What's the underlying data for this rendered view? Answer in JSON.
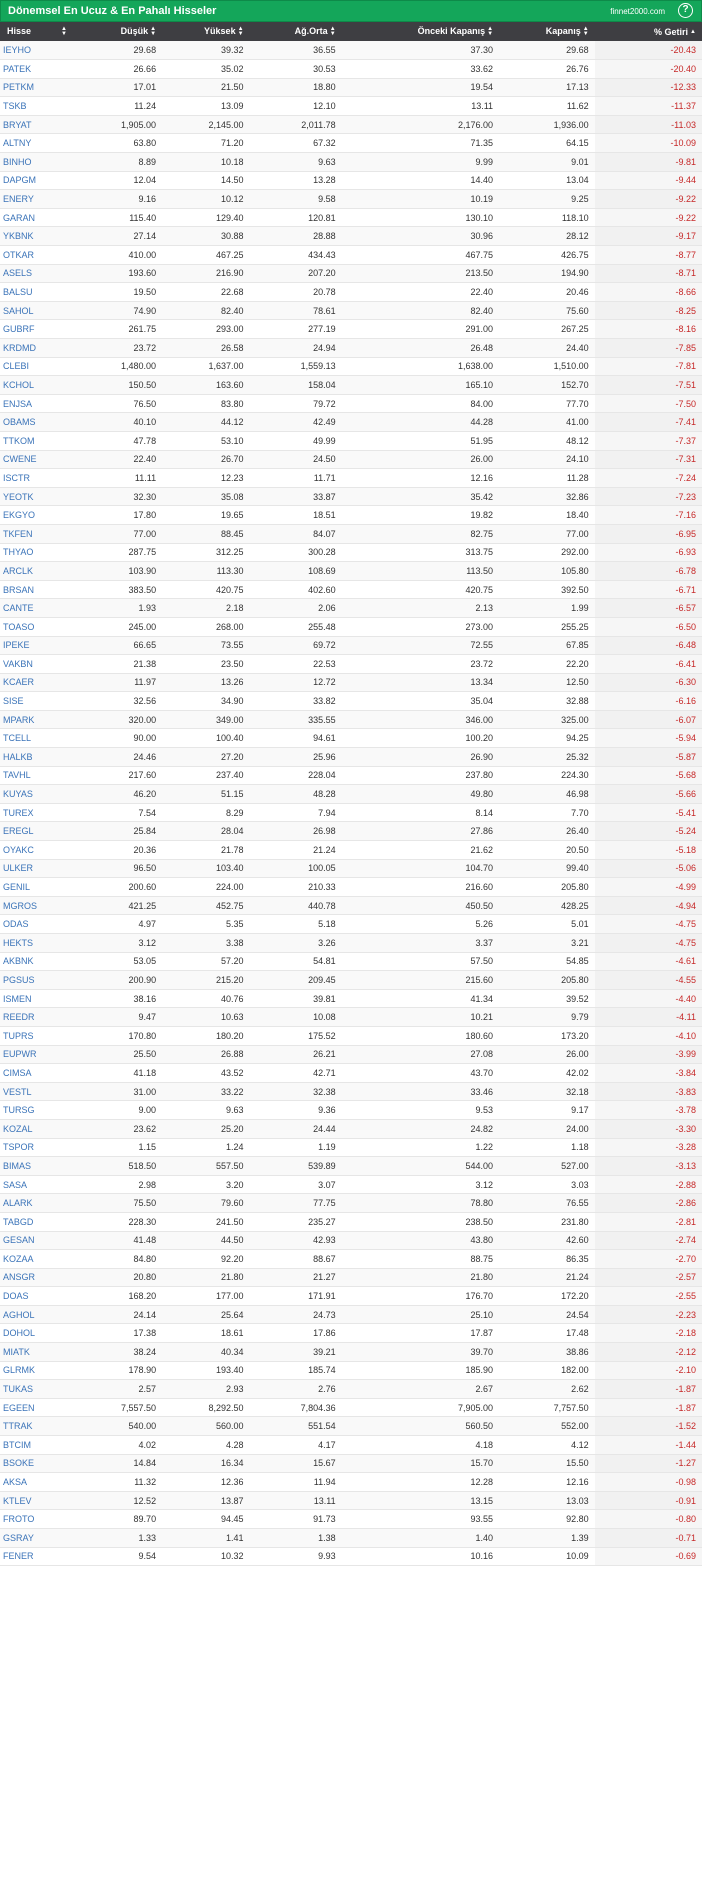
{
  "header": {
    "title": "Dönemsel En Ucuz & En Pahalı Hisseler",
    "brand": "finnet2000.com",
    "help": "?"
  },
  "columns": [
    "Hisse",
    "Düşük",
    "Yüksek",
    "Ağ.Orta",
    "Önceki Kapanış",
    "Kapanış",
    "% Getiri"
  ],
  "colors": {
    "header_bg": "#14a65a",
    "table_head_bg": "#3e3e42",
    "link": "#3a73b8",
    "negative": "#c62828"
  },
  "rows": [
    [
      "IEYHO",
      "29.68",
      "39.32",
      "36.55",
      "37.30",
      "29.68",
      "-20.43"
    ],
    [
      "PATEK",
      "26.66",
      "35.02",
      "30.53",
      "33.62",
      "26.76",
      "-20.40"
    ],
    [
      "PETKM",
      "17.01",
      "21.50",
      "18.80",
      "19.54",
      "17.13",
      "-12.33"
    ],
    [
      "TSKB",
      "11.24",
      "13.09",
      "12.10",
      "13.11",
      "11.62",
      "-11.37"
    ],
    [
      "BRYAT",
      "1,905.00",
      "2,145.00",
      "2,011.78",
      "2,176.00",
      "1,936.00",
      "-11.03"
    ],
    [
      "ALTNY",
      "63.80",
      "71.20",
      "67.32",
      "71.35",
      "64.15",
      "-10.09"
    ],
    [
      "BINHO",
      "8.89",
      "10.18",
      "9.63",
      "9.99",
      "9.01",
      "-9.81"
    ],
    [
      "DAPGM",
      "12.04",
      "14.50",
      "13.28",
      "14.40",
      "13.04",
      "-9.44"
    ],
    [
      "ENERY",
      "9.16",
      "10.12",
      "9.58",
      "10.19",
      "9.25",
      "-9.22"
    ],
    [
      "GARAN",
      "115.40",
      "129.40",
      "120.81",
      "130.10",
      "118.10",
      "-9.22"
    ],
    [
      "YKBNK",
      "27.14",
      "30.88",
      "28.88",
      "30.96",
      "28.12",
      "-9.17"
    ],
    [
      "OTKAR",
      "410.00",
      "467.25",
      "434.43",
      "467.75",
      "426.75",
      "-8.77"
    ],
    [
      "ASELS",
      "193.60",
      "216.90",
      "207.20",
      "213.50",
      "194.90",
      "-8.71"
    ],
    [
      "BALSU",
      "19.50",
      "22.68",
      "20.78",
      "22.40",
      "20.46",
      "-8.66"
    ],
    [
      "SAHOL",
      "74.90",
      "82.40",
      "78.61",
      "82.40",
      "75.60",
      "-8.25"
    ],
    [
      "GUBRF",
      "261.75",
      "293.00",
      "277.19",
      "291.00",
      "267.25",
      "-8.16"
    ],
    [
      "KRDMD",
      "23.72",
      "26.58",
      "24.94",
      "26.48",
      "24.40",
      "-7.85"
    ],
    [
      "CLEBI",
      "1,480.00",
      "1,637.00",
      "1,559.13",
      "1,638.00",
      "1,510.00",
      "-7.81"
    ],
    [
      "KCHOL",
      "150.50",
      "163.60",
      "158.04",
      "165.10",
      "152.70",
      "-7.51"
    ],
    [
      "ENJSA",
      "76.50",
      "83.80",
      "79.72",
      "84.00",
      "77.70",
      "-7.50"
    ],
    [
      "OBAMS",
      "40.10",
      "44.12",
      "42.49",
      "44.28",
      "41.00",
      "-7.41"
    ],
    [
      "TTKOM",
      "47.78",
      "53.10",
      "49.99",
      "51.95",
      "48.12",
      "-7.37"
    ],
    [
      "CWENE",
      "22.40",
      "26.70",
      "24.50",
      "26.00",
      "24.10",
      "-7.31"
    ],
    [
      "ISCTR",
      "11.11",
      "12.23",
      "11.71",
      "12.16",
      "11.28",
      "-7.24"
    ],
    [
      "YEOTK",
      "32.30",
      "35.08",
      "33.87",
      "35.42",
      "32.86",
      "-7.23"
    ],
    [
      "EKGYO",
      "17.80",
      "19.65",
      "18.51",
      "19.82",
      "18.40",
      "-7.16"
    ],
    [
      "TKFEN",
      "77.00",
      "88.45",
      "84.07",
      "82.75",
      "77.00",
      "-6.95"
    ],
    [
      "THYAO",
      "287.75",
      "312.25",
      "300.28",
      "313.75",
      "292.00",
      "-6.93"
    ],
    [
      "ARCLK",
      "103.90",
      "113.30",
      "108.69",
      "113.50",
      "105.80",
      "-6.78"
    ],
    [
      "BRSAN",
      "383.50",
      "420.75",
      "402.60",
      "420.75",
      "392.50",
      "-6.71"
    ],
    [
      "CANTE",
      "1.93",
      "2.18",
      "2.06",
      "2.13",
      "1.99",
      "-6.57"
    ],
    [
      "TOASO",
      "245.00",
      "268.00",
      "255.48",
      "273.00",
      "255.25",
      "-6.50"
    ],
    [
      "IPEKE",
      "66.65",
      "73.55",
      "69.72",
      "72.55",
      "67.85",
      "-6.48"
    ],
    [
      "VAKBN",
      "21.38",
      "23.50",
      "22.53",
      "23.72",
      "22.20",
      "-6.41"
    ],
    [
      "KCAER",
      "11.97",
      "13.26",
      "12.72",
      "13.34",
      "12.50",
      "-6.30"
    ],
    [
      "SISE",
      "32.56",
      "34.90",
      "33.82",
      "35.04",
      "32.88",
      "-6.16"
    ],
    [
      "MPARK",
      "320.00",
      "349.00",
      "335.55",
      "346.00",
      "325.00",
      "-6.07"
    ],
    [
      "TCELL",
      "90.00",
      "100.40",
      "94.61",
      "100.20",
      "94.25",
      "-5.94"
    ],
    [
      "HALKB",
      "24.46",
      "27.20",
      "25.96",
      "26.90",
      "25.32",
      "-5.87"
    ],
    [
      "TAVHL",
      "217.60",
      "237.40",
      "228.04",
      "237.80",
      "224.30",
      "-5.68"
    ],
    [
      "KUYAS",
      "46.20",
      "51.15",
      "48.28",
      "49.80",
      "46.98",
      "-5.66"
    ],
    [
      "TUREX",
      "7.54",
      "8.29",
      "7.94",
      "8.14",
      "7.70",
      "-5.41"
    ],
    [
      "EREGL",
      "25.84",
      "28.04",
      "26.98",
      "27.86",
      "26.40",
      "-5.24"
    ],
    [
      "OYAKC",
      "20.36",
      "21.78",
      "21.24",
      "21.62",
      "20.50",
      "-5.18"
    ],
    [
      "ULKER",
      "96.50",
      "103.40",
      "100.05",
      "104.70",
      "99.40",
      "-5.06"
    ],
    [
      "GENIL",
      "200.60",
      "224.00",
      "210.33",
      "216.60",
      "205.80",
      "-4.99"
    ],
    [
      "MGROS",
      "421.25",
      "452.75",
      "440.78",
      "450.50",
      "428.25",
      "-4.94"
    ],
    [
      "ODAS",
      "4.97",
      "5.35",
      "5.18",
      "5.26",
      "5.01",
      "-4.75"
    ],
    [
      "HEKTS",
      "3.12",
      "3.38",
      "3.26",
      "3.37",
      "3.21",
      "-4.75"
    ],
    [
      "AKBNK",
      "53.05",
      "57.20",
      "54.81",
      "57.50",
      "54.85",
      "-4.61"
    ],
    [
      "PGSUS",
      "200.90",
      "215.20",
      "209.45",
      "215.60",
      "205.80",
      "-4.55"
    ],
    [
      "ISMEN",
      "38.16",
      "40.76",
      "39.81",
      "41.34",
      "39.52",
      "-4.40"
    ],
    [
      "REEDR",
      "9.47",
      "10.63",
      "10.08",
      "10.21",
      "9.79",
      "-4.11"
    ],
    [
      "TUPRS",
      "170.80",
      "180.20",
      "175.52",
      "180.60",
      "173.20",
      "-4.10"
    ],
    [
      "EUPWR",
      "25.50",
      "26.88",
      "26.21",
      "27.08",
      "26.00",
      "-3.99"
    ],
    [
      "CIMSA",
      "41.18",
      "43.52",
      "42.71",
      "43.70",
      "42.02",
      "-3.84"
    ],
    [
      "VESTL",
      "31.00",
      "33.22",
      "32.38",
      "33.46",
      "32.18",
      "-3.83"
    ],
    [
      "TURSG",
      "9.00",
      "9.63",
      "9.36",
      "9.53",
      "9.17",
      "-3.78"
    ],
    [
      "KOZAL",
      "23.62",
      "25.20",
      "24.44",
      "24.82",
      "24.00",
      "-3.30"
    ],
    [
      "TSPOR",
      "1.15",
      "1.24",
      "1.19",
      "1.22",
      "1.18",
      "-3.28"
    ],
    [
      "BIMAS",
      "518.50",
      "557.50",
      "539.89",
      "544.00",
      "527.00",
      "-3.13"
    ],
    [
      "SASA",
      "2.98",
      "3.20",
      "3.07",
      "3.12",
      "3.03",
      "-2.88"
    ],
    [
      "ALARK",
      "75.50",
      "79.60",
      "77.75",
      "78.80",
      "76.55",
      "-2.86"
    ],
    [
      "TABGD",
      "228.30",
      "241.50",
      "235.27",
      "238.50",
      "231.80",
      "-2.81"
    ],
    [
      "GESAN",
      "41.48",
      "44.50",
      "42.93",
      "43.80",
      "42.60",
      "-2.74"
    ],
    [
      "KOZAA",
      "84.80",
      "92.20",
      "88.67",
      "88.75",
      "86.35",
      "-2.70"
    ],
    [
      "ANSGR",
      "20.80",
      "21.80",
      "21.27",
      "21.80",
      "21.24",
      "-2.57"
    ],
    [
      "DOAS",
      "168.20",
      "177.00",
      "171.91",
      "176.70",
      "172.20",
      "-2.55"
    ],
    [
      "AGHOL",
      "24.14",
      "25.64",
      "24.73",
      "25.10",
      "24.54",
      "-2.23"
    ],
    [
      "DOHOL",
      "17.38",
      "18.61",
      "17.86",
      "17.87",
      "17.48",
      "-2.18"
    ],
    [
      "MIATK",
      "38.24",
      "40.34",
      "39.21",
      "39.70",
      "38.86",
      "-2.12"
    ],
    [
      "GLRMK",
      "178.90",
      "193.40",
      "185.74",
      "185.90",
      "182.00",
      "-2.10"
    ],
    [
      "TUKAS",
      "2.57",
      "2.93",
      "2.76",
      "2.67",
      "2.62",
      "-1.87"
    ],
    [
      "EGEEN",
      "7,557.50",
      "8,292.50",
      "7,804.36",
      "7,905.00",
      "7,757.50",
      "-1.87"
    ],
    [
      "TTRAK",
      "540.00",
      "560.00",
      "551.54",
      "560.50",
      "552.00",
      "-1.52"
    ],
    [
      "BTCIM",
      "4.02",
      "4.28",
      "4.17",
      "4.18",
      "4.12",
      "-1.44"
    ],
    [
      "BSOKE",
      "14.84",
      "16.34",
      "15.67",
      "15.70",
      "15.50",
      "-1.27"
    ],
    [
      "AKSA",
      "11.32",
      "12.36",
      "11.94",
      "12.28",
      "12.16",
      "-0.98"
    ],
    [
      "KTLEV",
      "12.52",
      "13.87",
      "13.11",
      "13.15",
      "13.03",
      "-0.91"
    ],
    [
      "FROTO",
      "89.70",
      "94.45",
      "91.73",
      "93.55",
      "92.80",
      "-0.80"
    ],
    [
      "GSRAY",
      "1.33",
      "1.41",
      "1.38",
      "1.40",
      "1.39",
      "-0.71"
    ],
    [
      "FENER",
      "9.54",
      "10.32",
      "9.93",
      "10.16",
      "10.09",
      "-0.69"
    ]
  ]
}
